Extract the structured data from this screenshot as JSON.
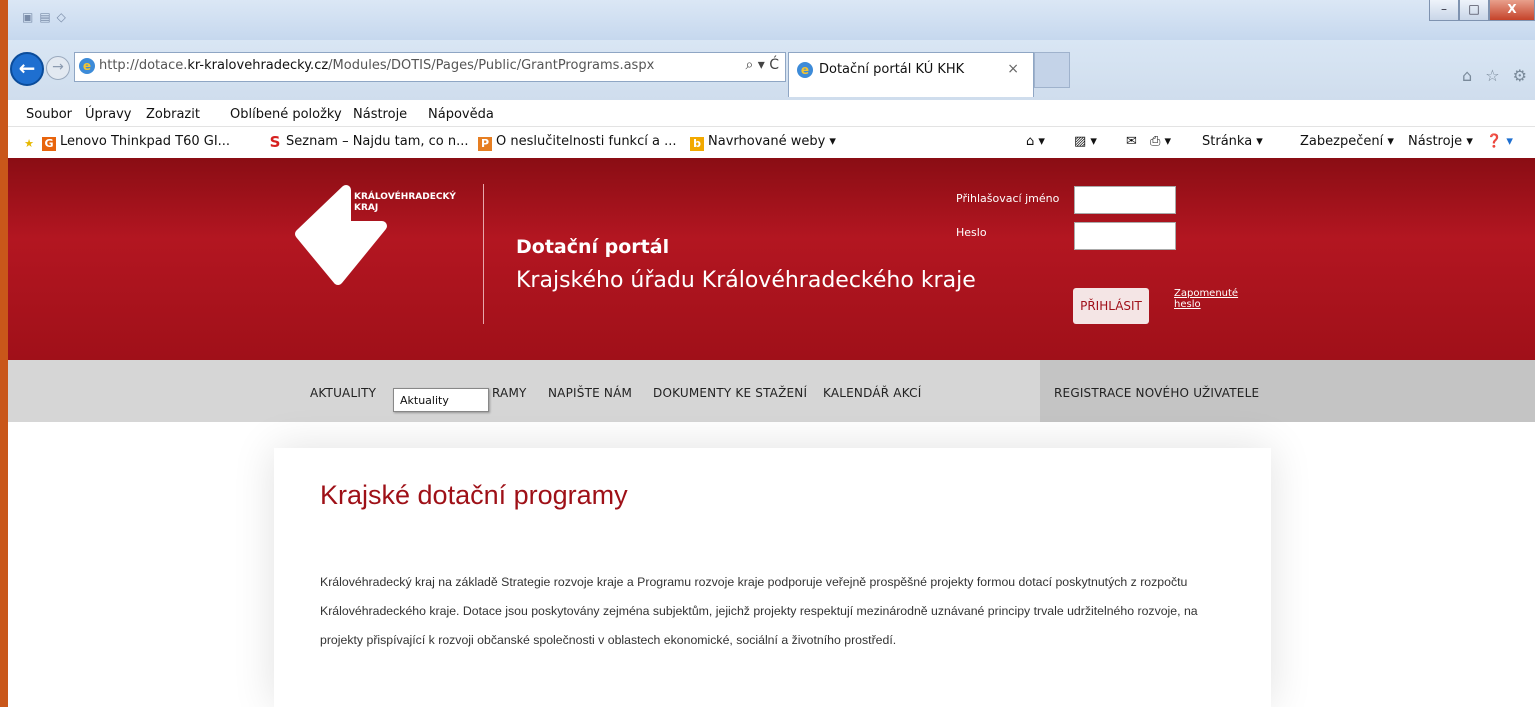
{
  "browser": {
    "url_prefix": "http://dotace.",
    "url_domain": "kr-kralovehradecky.cz",
    "url_path": "/Modules/DOTIS/Pages/Public/GrantPrograms.aspx",
    "search_ctl": "⌕ ▾ Ć",
    "tab_title": "Dotační portál KÚ KHK",
    "tab_close": "×",
    "window_buttons": [
      "–",
      "□",
      "X"
    ],
    "right_icons": "⌂ ☆ ⚙"
  },
  "menu": [
    "Soubor",
    "Úpravy",
    "Zobrazit",
    "Oblíbené položky",
    "Nástroje",
    "Nápověda"
  ],
  "favorites": [
    {
      "label": "Lenovo Thinkpad T60  GI...",
      "icon": "G",
      "color": "#e8640c"
    },
    {
      "label": "Seznam – Najdu tam, co n...",
      "icon": "S",
      "color": "#d6201f"
    },
    {
      "label": "O neslučitelnosti funkcí a ...",
      "icon": "P",
      "color": "#e67e22"
    },
    {
      "label": "Navrhované weby ▾",
      "icon": "b",
      "color": "#f2a900"
    }
  ],
  "commands": {
    "home": "⌂ ▾",
    "feeds": "▨ ▾",
    "mail": "✉",
    "print": "⎙ ▾",
    "page": "Stránka ▾",
    "security": "Zabezpečení ▾",
    "tools": "Nástroje ▾",
    "help": "❓ ▾"
  },
  "site": {
    "logo_line1": "KRÁLOVÉHRADECKÝ",
    "logo_line2": "KRAJ",
    "portal_title": "Dotační portál",
    "portal_subtitle": "Krajského úřadu Královéhradeckého kraje",
    "login_label": "Přihlašovací jméno",
    "password_label": "Heslo",
    "login_button": "PŘIHLÁSIT",
    "forgot_line1": "Zapomenuté",
    "forgot_line2": "heslo"
  },
  "nav": {
    "news": "AKTUALITY",
    "programs": "RAMY",
    "write": "NAPIŠTE NÁM",
    "docs": "DOKUMENTY KE STAŽENÍ",
    "calendar": "KALENDÁŘ AKCÍ",
    "register": "REGISTRACE NOVÉHO UŽIVATELE",
    "tooltip": "Aktuality"
  },
  "content": {
    "title": "Krajské dotační programy",
    "paragraph": "Královéhradecký kraj na základě Strategie rozvoje kraje a Programu rozvoje kraje podporuje veřejně prospěšné projekty formou dotací poskytnutých z rozpočtu Královéhradeckého kraje. Dotace jsou poskytovány zejména subjektům, jejichž projekty respektují mezinárodně uznávané principy trvale udržitelného rozvoje, na projekty přispívající k rozvoji občanské společnosti v oblastech ekonomické, sociální a životního prostředí."
  },
  "colors": {
    "brand_red": "#a01019",
    "nav_gray": "#d6d6d6",
    "orange_frame": "#c9571a"
  }
}
